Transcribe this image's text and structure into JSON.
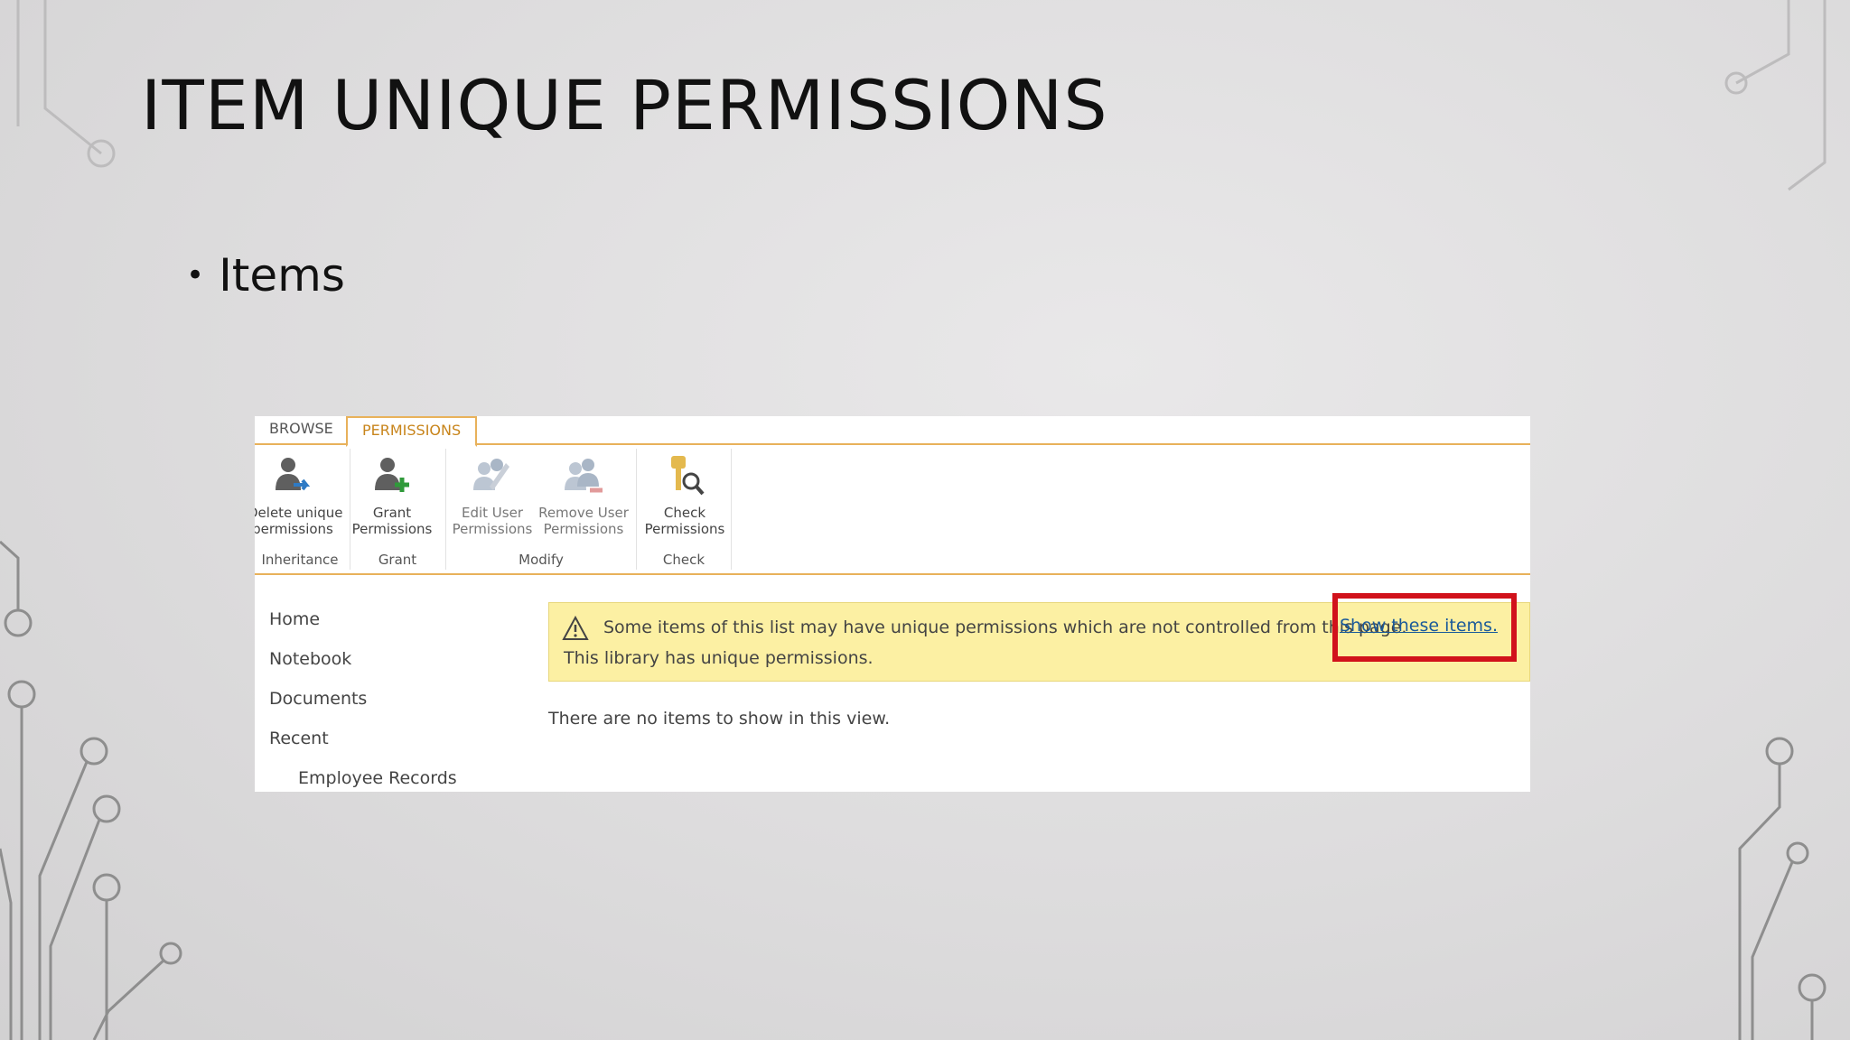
{
  "slide": {
    "title": "ITEM UNIQUE PERMISSIONS",
    "bullet": "Items"
  },
  "ribbon": {
    "tabs": [
      "BROWSE",
      "PERMISSIONS"
    ],
    "buttons": {
      "delete_unique_1": "Delete unique",
      "delete_unique_2": "permissions",
      "grant_1": "Grant",
      "grant_2": "Permissions",
      "edit_1": "Edit User",
      "edit_2": "Permissions",
      "remove_1": "Remove User",
      "remove_2": "Permissions",
      "check_1": "Check",
      "check_2": "Permissions"
    },
    "groups": [
      "Inheritance",
      "Grant",
      "Modify",
      "Check"
    ],
    "icons": {
      "delete": "user-arrow-icon",
      "grant": "user-plus-icon",
      "edit": "users-edit-icon",
      "remove": "users-minus-icon",
      "check": "key-search-icon"
    }
  },
  "nav": {
    "items": [
      "Home",
      "Notebook",
      "Documents",
      "Recent"
    ],
    "sub_items": [
      "Employee Records"
    ]
  },
  "notice": {
    "line1": "Some items of this list may have unique permissions which are not controlled from this page.",
    "link": "Show these items.",
    "line2": "This library has unique permissions."
  },
  "content": {
    "empty_message": "There are no items to show in this view."
  },
  "colors": {
    "accent": "#e8b15a",
    "notice_bg": "#fcf0a3",
    "highlight": "#d1121b",
    "link": "#1a5a9a"
  }
}
